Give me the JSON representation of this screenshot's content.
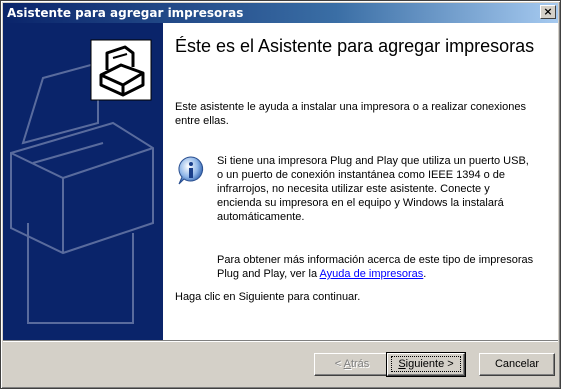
{
  "window": {
    "title": "Asistente para agregar impresoras",
    "close_glyph": "×"
  },
  "content": {
    "heading": "Éste es el Asistente para agregar impresoras",
    "intro": "Este asistente le ayuda a instalar una impresora o a realizar conexiones entre ellas.",
    "info_text": "Si tiene una impresora Plug and Play que utiliza un puerto USB, o un puerto de conexión instantánea como IEEE 1394 o de infrarrojos, no necesita utilizar este asistente. Conecte y encienda su impresora en el equipo y Windows la instalará automáticamente.",
    "more_info_prefix": "Para obtener más información acerca de este tipo de impresoras Plug and Play, ver la ",
    "more_info_link": "Ayuda de impresoras",
    "more_info_suffix": ".",
    "continue_text": "Haga clic en Siguiente para continuar."
  },
  "buttons": {
    "back_arrow": "< ",
    "back_hotkey": "A",
    "back_rest": "trás",
    "next_hotkey": "S",
    "next_rest": "iguiente >",
    "cancel": "Cancelar"
  },
  "colors": {
    "sidebar": "#0a246a",
    "titlebar_start": "#0a246a",
    "titlebar_end": "#a6caf0",
    "link": "#0000ff"
  },
  "icons": {
    "printer": "printer-icon",
    "info": "info-icon",
    "close": "close-icon"
  }
}
